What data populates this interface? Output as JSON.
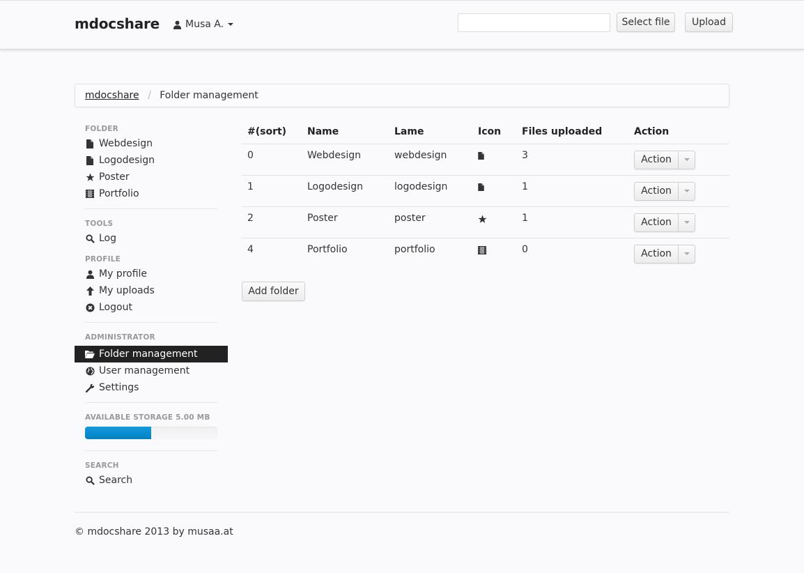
{
  "navbar": {
    "brand": "mdocshare",
    "user": {
      "name": "Musa A.",
      "icon": "user-icon"
    },
    "file_input": {
      "value": "",
      "placeholder": ""
    },
    "select_file_label": "Select file",
    "upload_label": "Upload"
  },
  "breadcrumb": {
    "items": [
      {
        "label": "mdocshare",
        "link": true
      },
      {
        "label": "Folder management",
        "link": false
      }
    ],
    "separator": "/"
  },
  "sidebar": {
    "sections": [
      {
        "header": "Folder",
        "items": [
          {
            "label": "Webdesign",
            "icon": "file-icon"
          },
          {
            "label": "Logodesign",
            "icon": "file-icon"
          },
          {
            "label": "Poster",
            "icon": "star-icon"
          },
          {
            "label": "Portfolio",
            "icon": "film-icon"
          }
        ]
      },
      {
        "header": "Tools",
        "items": [
          {
            "label": "Log",
            "icon": "search-icon"
          }
        ]
      },
      {
        "header": "Profile",
        "items": [
          {
            "label": "My profile",
            "icon": "user-icon"
          },
          {
            "label": "My uploads",
            "icon": "arrow-up-icon"
          },
          {
            "label": "Logout",
            "icon": "remove-circle-icon"
          }
        ]
      },
      {
        "header": "Administrator",
        "items": [
          {
            "label": "Folder management",
            "icon": "folder-open-icon",
            "active": true
          },
          {
            "label": "User management",
            "icon": "globe-icon"
          },
          {
            "label": "Settings",
            "icon": "wrench-icon"
          }
        ]
      },
      {
        "header": "Available storage 5.00 MB",
        "storage_used_percent": 50
      },
      {
        "header": "Search",
        "items": [
          {
            "label": "Search",
            "icon": "search-icon"
          }
        ]
      }
    ]
  },
  "table": {
    "columns": [
      "#(sort)",
      "Name",
      "Lame",
      "Icon",
      "Files uploaded",
      "Action"
    ],
    "rows": [
      {
        "sort": "0",
        "name": "Webdesign",
        "lame": "webdesign",
        "icon": "file-icon",
        "files": "3",
        "action": "Action"
      },
      {
        "sort": "1",
        "name": "Logodesign",
        "lame": "logodesign",
        "icon": "file-icon",
        "files": "1",
        "action": "Action"
      },
      {
        "sort": "2",
        "name": "Poster",
        "lame": "poster",
        "icon": "star-icon",
        "files": "1",
        "action": "Action"
      },
      {
        "sort": "4",
        "name": "Portfolio",
        "lame": "portfolio",
        "icon": "film-icon",
        "files": "0",
        "action": "Action"
      }
    ],
    "add_folder_label": "Add folder"
  },
  "footer": {
    "text": "© mdocshare 2013 by musaa.at"
  },
  "colors": {
    "progress": "#0e90d2",
    "active_nav_bg": "#222222",
    "page_bg": "#fafafc"
  }
}
